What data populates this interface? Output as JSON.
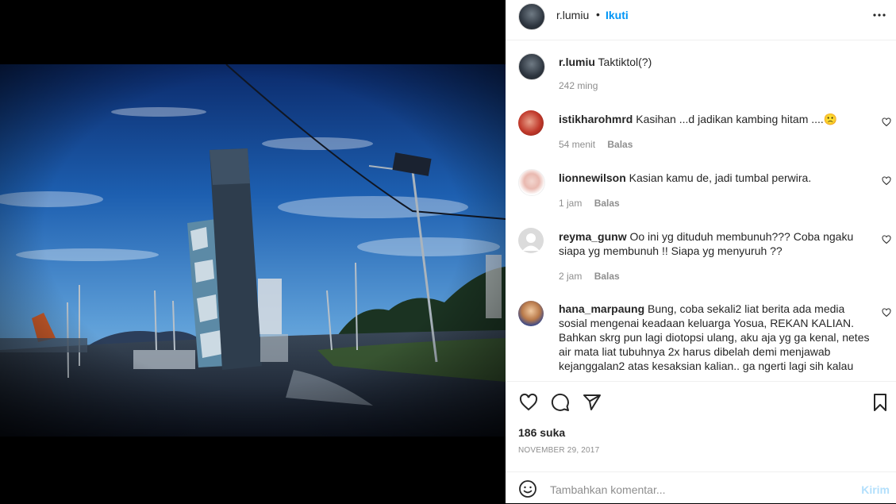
{
  "post": {
    "username": "r.lumiu",
    "follow_label": "Ikuti",
    "separator": "•",
    "more_icon": "more-dots-icon",
    "caption_username": "r.lumiu",
    "caption_text": "Taktiktol(?)",
    "caption_time": "242 ming"
  },
  "comments": [
    {
      "username": "istikharohmrd",
      "text": "Kasihan ...d jadikan kambing hitam ....🙁",
      "time": "54 menit",
      "reply": "Balas"
    },
    {
      "username": "lionnewilson",
      "text": "Kasian kamu de, jadi tumbal perwira.",
      "time": "1 jam",
      "reply": "Balas"
    },
    {
      "username": "reyma_gunw",
      "text": "Oo ini yg dituduh membunuh??? Coba ngaku siapa yg membunuh !! Siapa yg menyuruh ??",
      "time": "2 jam",
      "reply": "Balas"
    },
    {
      "username": "hana_marpaung",
      "text": "Bung, coba sekali2 liat berita ada media sosial mengenai keadaan keluarga Yosua, REKAN KALIAN. Bahkan skrg pun lagi diotopsi ulang, aku aja yg ga kenal, netes air mata liat tubuhnya 2x harus dibelah demi menjawab kejanggalan2 atas kesaksian kalian.. ga ngerti lagi sih kalau",
      "time": "",
      "reply": ""
    }
  ],
  "actions": {
    "likes": "186 suka",
    "date": "NOVEMBER 29, 2017",
    "icons": [
      "heart-icon",
      "comment-icon",
      "share-icon",
      "bookmark-icon"
    ]
  },
  "add_comment": {
    "placeholder": "Tambahkan komentar...",
    "send_label": "Kirim",
    "emoji_icon": "emoji-icon"
  },
  "colors": {
    "follow": "#0095f6",
    "send_disabled": "#b2dffc",
    "meta": "#8e8e8e"
  }
}
